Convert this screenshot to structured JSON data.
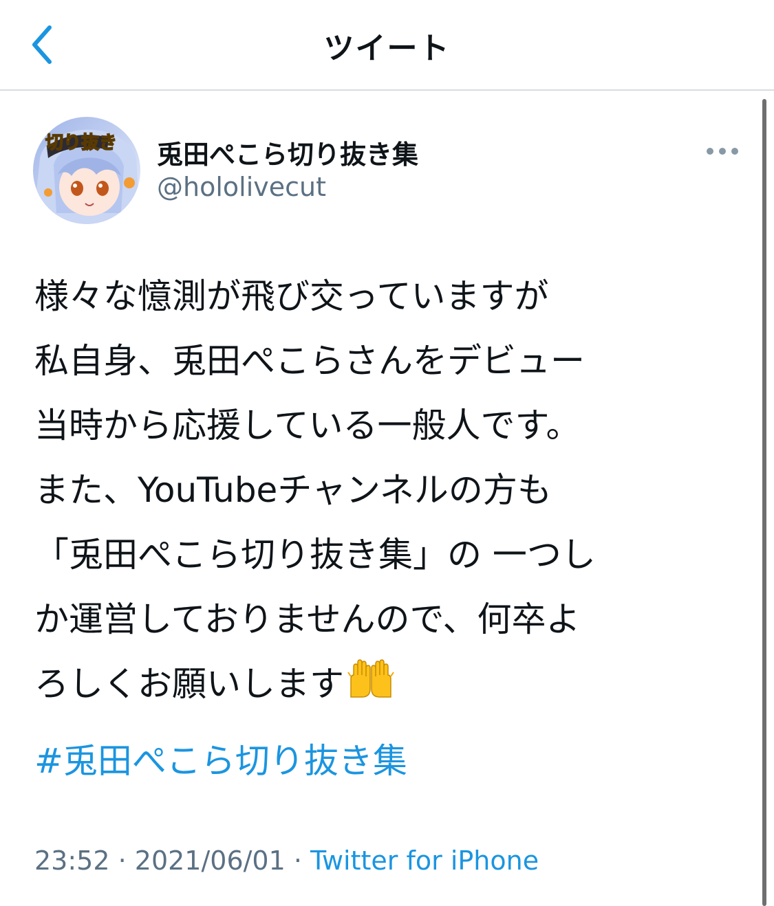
{
  "nav": {
    "title": "ツイート",
    "back_icon": "chevron-left-icon",
    "accent_color": "#1b95e0"
  },
  "tweet": {
    "avatar_label": "切り抜き",
    "display_name": "兎田ぺこら切り抜き集",
    "handle": "@hololivecut",
    "more_icon": "more-dots-icon",
    "text_lines": [
      "様々な憶測が飛び交っていますが",
      "私自身、兎田ぺこらさんをデビュー",
      "当時から応援している一般人です。",
      "また、YouTubeチャンネルの方も",
      "「兎田ぺこら切り抜き集」の 一つし",
      "か運営しておりませんので、何卒よ",
      "ろしくお願いします"
    ],
    "emoji": "raising-hands-icon",
    "hashtag": "#兎田ぺこら切り抜き集",
    "time": "23:52",
    "date": "2021/06/01",
    "separator": " · ",
    "source": "Twitter for iPhone"
  }
}
